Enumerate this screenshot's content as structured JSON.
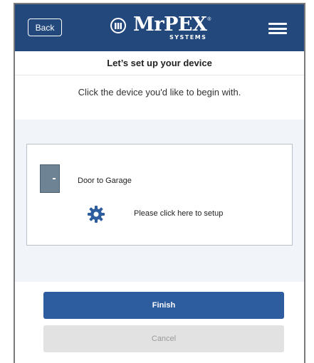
{
  "header": {
    "back_label": "Back",
    "brand_name": "MrPEX",
    "brand_sub": "SYSTEMS",
    "brand_tm": "®",
    "bg_color": "#22487c",
    "menu_icon": "hamburger-icon",
    "logo_icon": "m-circle-logo"
  },
  "setup": {
    "title": "Let’s set up your device",
    "instruction": "Click the device you'd like to begin with."
  },
  "device": {
    "name": "Door to Garage",
    "icon": "door-icon",
    "setup_icon": "gear-icon",
    "setup_text": "Please click here to setup",
    "accent_color": "#2e5d9f"
  },
  "actions": {
    "finish_label": "Finish",
    "cancel_label": "Cancel",
    "finish_color": "#2e5d9f"
  }
}
